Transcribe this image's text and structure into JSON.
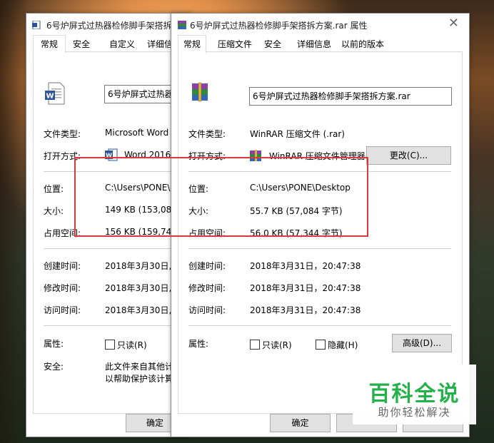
{
  "watermark": {
    "title": "百科全说",
    "subtitle": "助你轻松解决"
  },
  "dialog_back": {
    "title": "6号炉屏式过热器检修脚手架搭拆方",
    "tabs": [
      "常规",
      "安全",
      "自定义",
      "详细信息"
    ],
    "active_tab": 0,
    "filename": "6号炉屏式过热器检",
    "file_type_label": "文件类型:",
    "file_type_value": "Microsoft Word",
    "open_with_label": "打开方式:",
    "open_with_value": "Word 2016",
    "location_label": "位置:",
    "location_value": "C:\\Users\\PONE\\D",
    "size_label": "大小:",
    "size_value": "149 KB (153,088",
    "disk_label": "占用空间:",
    "disk_value": "156 KB (159,744",
    "created_label": "创建时间:",
    "created_value": "2018年3月30日,",
    "modified_label": "修改时间:",
    "modified_value": "2018年3月30日,",
    "accessed_label": "访问时间:",
    "accessed_value": "2018年3月30日,",
    "attr_label": "属性:",
    "readonly_label": "只读(R)",
    "security_label": "安全:",
    "security_line1": "此文件来自其他计",
    "security_line2": "以帮助保护该计算",
    "ok_label": "确定"
  },
  "dialog_front": {
    "title": "6号炉屏式过热器检修脚手架搭拆方案.rar 属性",
    "tabs": [
      "常规",
      "压缩文件",
      "安全",
      "详细信息",
      "以前的版本"
    ],
    "active_tab": 0,
    "filename": "6号炉屏式过热器检修脚手架搭拆方案.rar",
    "file_type_label": "文件类型:",
    "file_type_value": "WinRAR 压缩文件 (.rar)",
    "open_with_label": "打开方式:",
    "open_with_value": "WinRAR 压缩文件管理器",
    "change_button": "更改(C)...",
    "location_label": "位置:",
    "location_value": "C:\\Users\\PONE\\Desktop",
    "size_label": "大小:",
    "size_value": "55.7 KB (57,084 字节)",
    "disk_label": "占用空间:",
    "disk_value": "56.0 KB (57,344 字节)",
    "created_label": "创建时间:",
    "created_value": "2018年3月31日，20:47:38",
    "modified_label": "修改时间:",
    "modified_value": "2018年3月31日，20:47:38",
    "accessed_label": "访问时间:",
    "accessed_value": "2018年3月31日，20:47:38",
    "attr_label": "属性:",
    "readonly_label": "只读(R)",
    "hidden_label": "隐藏(H)",
    "advanced_button": "高级(D)...",
    "ok_label": "确定",
    "close_glyph": "✕"
  },
  "colors": {
    "highlight_border": "#d9393d",
    "watermark_green": "#25b14a"
  }
}
